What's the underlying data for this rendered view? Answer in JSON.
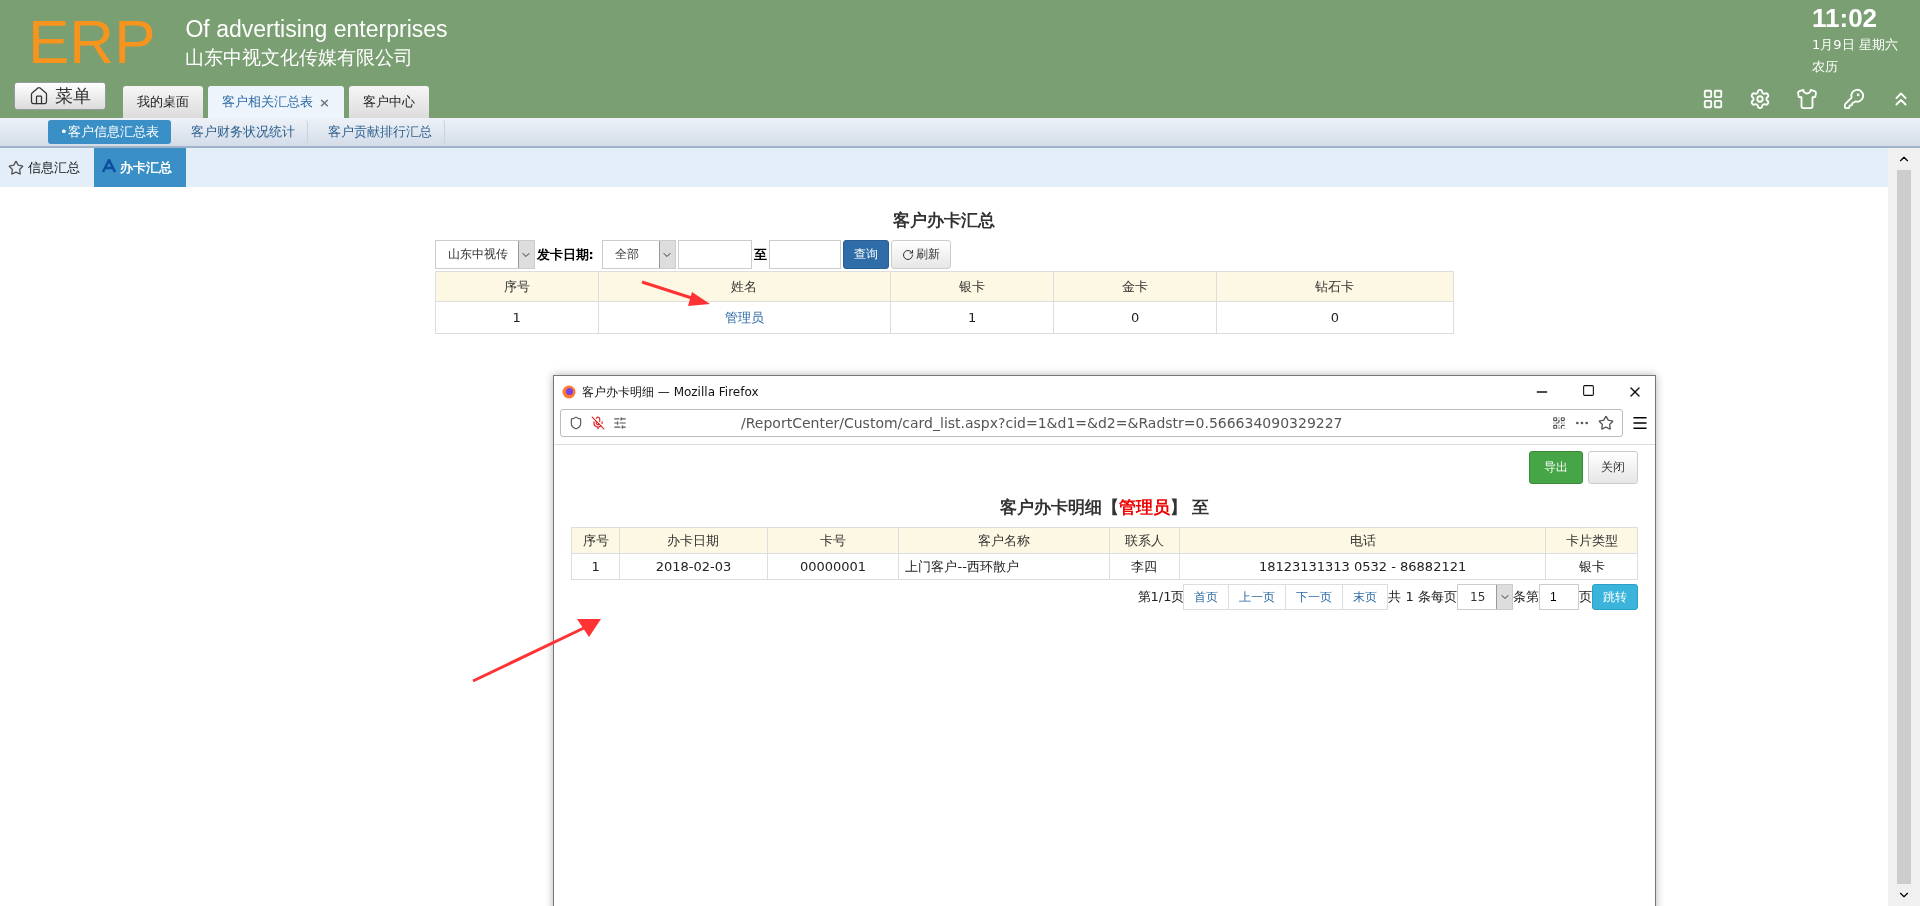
{
  "header": {
    "logo": "ERP",
    "title": "Of advertising enterprises",
    "company": "山东中视文化传媒有限公司",
    "menu_button": "菜单",
    "clock": {
      "time": "11:02",
      "date": "1月9日 星期六",
      "lunar": "农历"
    }
  },
  "tabs": [
    {
      "label": "我的桌面",
      "selected": false,
      "closable": false
    },
    {
      "label": "客户相关汇总表",
      "selected": true,
      "closable": true
    },
    {
      "label": "客户中心",
      "selected": false,
      "closable": false
    }
  ],
  "close_mark": "×",
  "subnav": [
    {
      "label": "•客户信息汇总表",
      "selected": true
    },
    {
      "label": "客户财务状况统计",
      "selected": false
    },
    {
      "label": "客户贡献排行汇总",
      "selected": false
    }
  ],
  "section_tabs": [
    {
      "label": "信息汇总",
      "selected": false
    },
    {
      "label": "办卡汇总",
      "selected": true
    }
  ],
  "report": {
    "title": "客户办卡汇总",
    "company_select": "山东中视传",
    "date_label": "发卡日期:",
    "range_select": "全部",
    "to_label": "至",
    "query_button": "查询",
    "refresh_button": "刷新",
    "columns": [
      "序号",
      "姓名",
      "银卡",
      "金卡",
      "钻石卡"
    ],
    "rows": [
      [
        "1",
        "管理员",
        "1",
        "0",
        "0"
      ]
    ]
  },
  "popup": {
    "title": "客户办卡明细 — Mozilla Firefox",
    "url": "/ReportCenter/Custom/card_list.aspx?cid=1&d1=&d2=&Radstr=0.566634090329227",
    "export_button": "导出",
    "close_button": "关闭",
    "heading": "客户办卡明细【**管理员**】 至",
    "columns": [
      "序号",
      "办卡日期",
      "卡号",
      "客户名称",
      "联系人",
      "电话",
      "卡片类型"
    ],
    "rows": [
      [
        "1",
        "2018-02-03",
        "00000001",
        "上门客户--西环散户",
        "李四",
        "18123131313 0532 - 86882121",
        "银卡"
      ]
    ],
    "pager": {
      "page_info": "第1/1页",
      "buttons": [
        "首页",
        "上一页",
        "下一页",
        "末页"
      ],
      "total": "共 1 条每页",
      "page_size": "15",
      "per_label": "条第",
      "page_input": "1",
      "page_label": "页",
      "go_button": "跳转"
    }
  }
}
